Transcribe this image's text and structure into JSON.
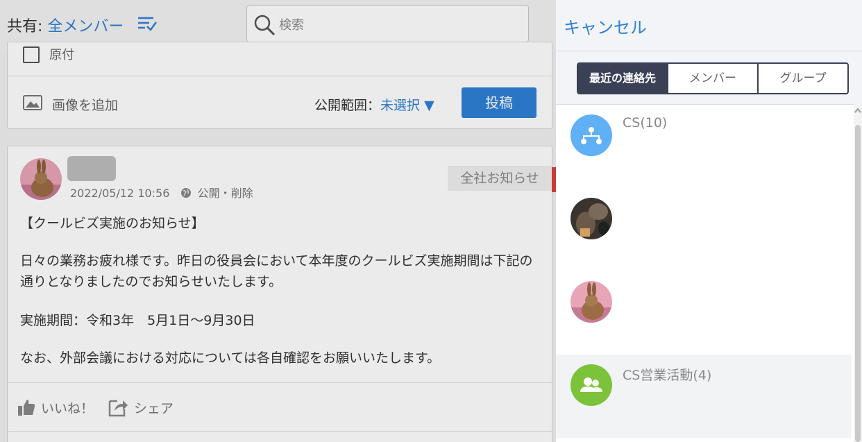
{
  "feed": {
    "share_label": "共有:",
    "share_value": "全メンバー",
    "search_placeholder": "検索",
    "composer": {
      "checkbox_label": "原付",
      "add_image": "画像を追加",
      "scope_label": "公開範囲：",
      "scope_value": "未選択",
      "scope_arrow": "▼",
      "post_button": "投稿"
    },
    "post": {
      "date": "2022/05/12 10:56",
      "visibility": "公開",
      "separator": "・",
      "delete": "削除",
      "tag": "全社お知らせ",
      "title": "【クールビズ実施のお知らせ】",
      "paragraph1": "日々の業務お疲れ様です。昨日の役員会において本年度のクールビズ実施期間は下記の通りとなりましたのでお知らせいたします。",
      "period": "実施期間：令和3年　5月1日～9月30日",
      "paragraph3": "なお、外部会議における対応については各自確認をお願いいたします。",
      "like": "いいね！",
      "share": "シェア"
    }
  },
  "panel": {
    "cancel": "キャンセル",
    "tabs": [
      {
        "label": "最近の連絡先",
        "active": true
      },
      {
        "label": "メンバー",
        "active": false
      },
      {
        "label": "グループ",
        "active": false
      }
    ],
    "items": [
      {
        "name": "CS(10)",
        "icon": "org-chart-icon",
        "color": "#5fb0f5"
      },
      {
        "name": "",
        "icon": "cat-avatar"
      },
      {
        "name": "",
        "icon": "rabbit-avatar"
      },
      {
        "name": "CS営業活動(4)",
        "icon": "group-icon",
        "color": "#7cc23a"
      }
    ]
  },
  "colors": {
    "accent": "#2f7fd6",
    "tab_active": "#3a4156"
  }
}
